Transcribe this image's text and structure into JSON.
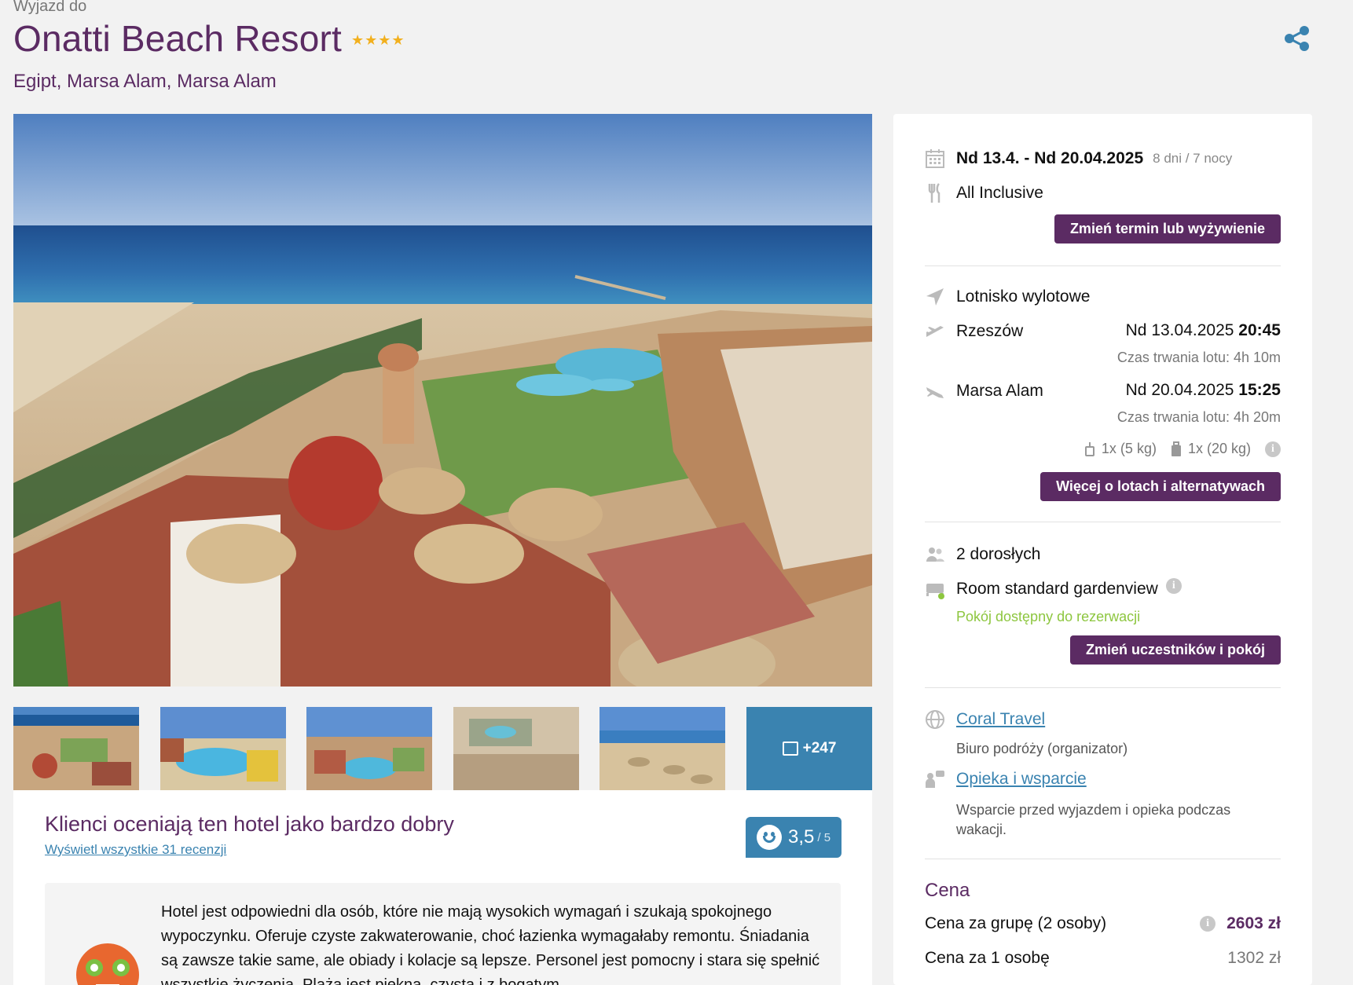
{
  "header": {
    "pretitle": "Wyjazd do",
    "hotel_name": "Onatti Beach Resort",
    "stars": "★★★★",
    "location": "Egipt, Marsa Alam, Marsa Alam",
    "share_icon": "share-icon"
  },
  "gallery": {
    "more_count": "+247"
  },
  "reviews": {
    "heading": "Klienci oceniają ten hotel jako bardzo dobry",
    "link": "Wyświetl wszystkie 31 recenzji",
    "score": "3,5",
    "score_max": "/ 5",
    "text": "Hotel jest odpowiedni dla osób, które nie mają wysokich wymagań i szukają spokojnego wypoczynku. Oferuje czyste zakwaterowanie, choć łazienka wymagałaby remontu. Śniadania są zawsze takie same, ale obiady i kolacje są lepsze. Personel jest pomocny i stara się spełnić wszystkie życzenia. Plaża jest piękna, czysta i z bogatym"
  },
  "booking": {
    "dates": "Nd 13.4. - Nd 20.04.2025",
    "duration": "8 dni / 7 nocy",
    "board": "All Inclusive",
    "change_term_button": "Zmień termin lub wyżywienie"
  },
  "flights": {
    "airport_label": "Lotnisko wylotowe",
    "outbound": {
      "city": "Rzeszów",
      "date": "Nd 13.04.2025",
      "time": "20:45",
      "duration": "Czas trwania lotu: 4h 10m"
    },
    "return": {
      "city": "Marsa Alam",
      "date": "Nd 20.04.2025",
      "time": "15:25",
      "duration": "Czas trwania lotu: 4h 20m"
    },
    "hand_luggage": "1x (5 kg)",
    "checked_luggage": "1x (20 kg)",
    "more_button": "Więcej o lotach i alternatywach"
  },
  "room": {
    "travellers": "2 dorosłych",
    "room_type": "Room standard gardenview",
    "availability": "Pokój dostępny do rezerwacji",
    "change_button": "Zmień uczestników i pokój"
  },
  "operator": {
    "name": "Coral Travel",
    "subtitle": "Biuro podróży (organizator)",
    "support_link": "Opieka i wsparcie",
    "support_text": "Wsparcie przed wyjazdem i opieka podczas wakacji."
  },
  "price": {
    "heading": "Cena",
    "group_label": "Cena za grupę (2 osoby)",
    "group_value": "2603 zł",
    "person_label": "Cena za 1 osobę",
    "person_value": "1302 zł"
  },
  "colors": {
    "brand_purple": "#5b2b63",
    "link_blue": "#3a83b0",
    "available_green": "#8dc63f",
    "star_gold": "#f2b01e"
  }
}
